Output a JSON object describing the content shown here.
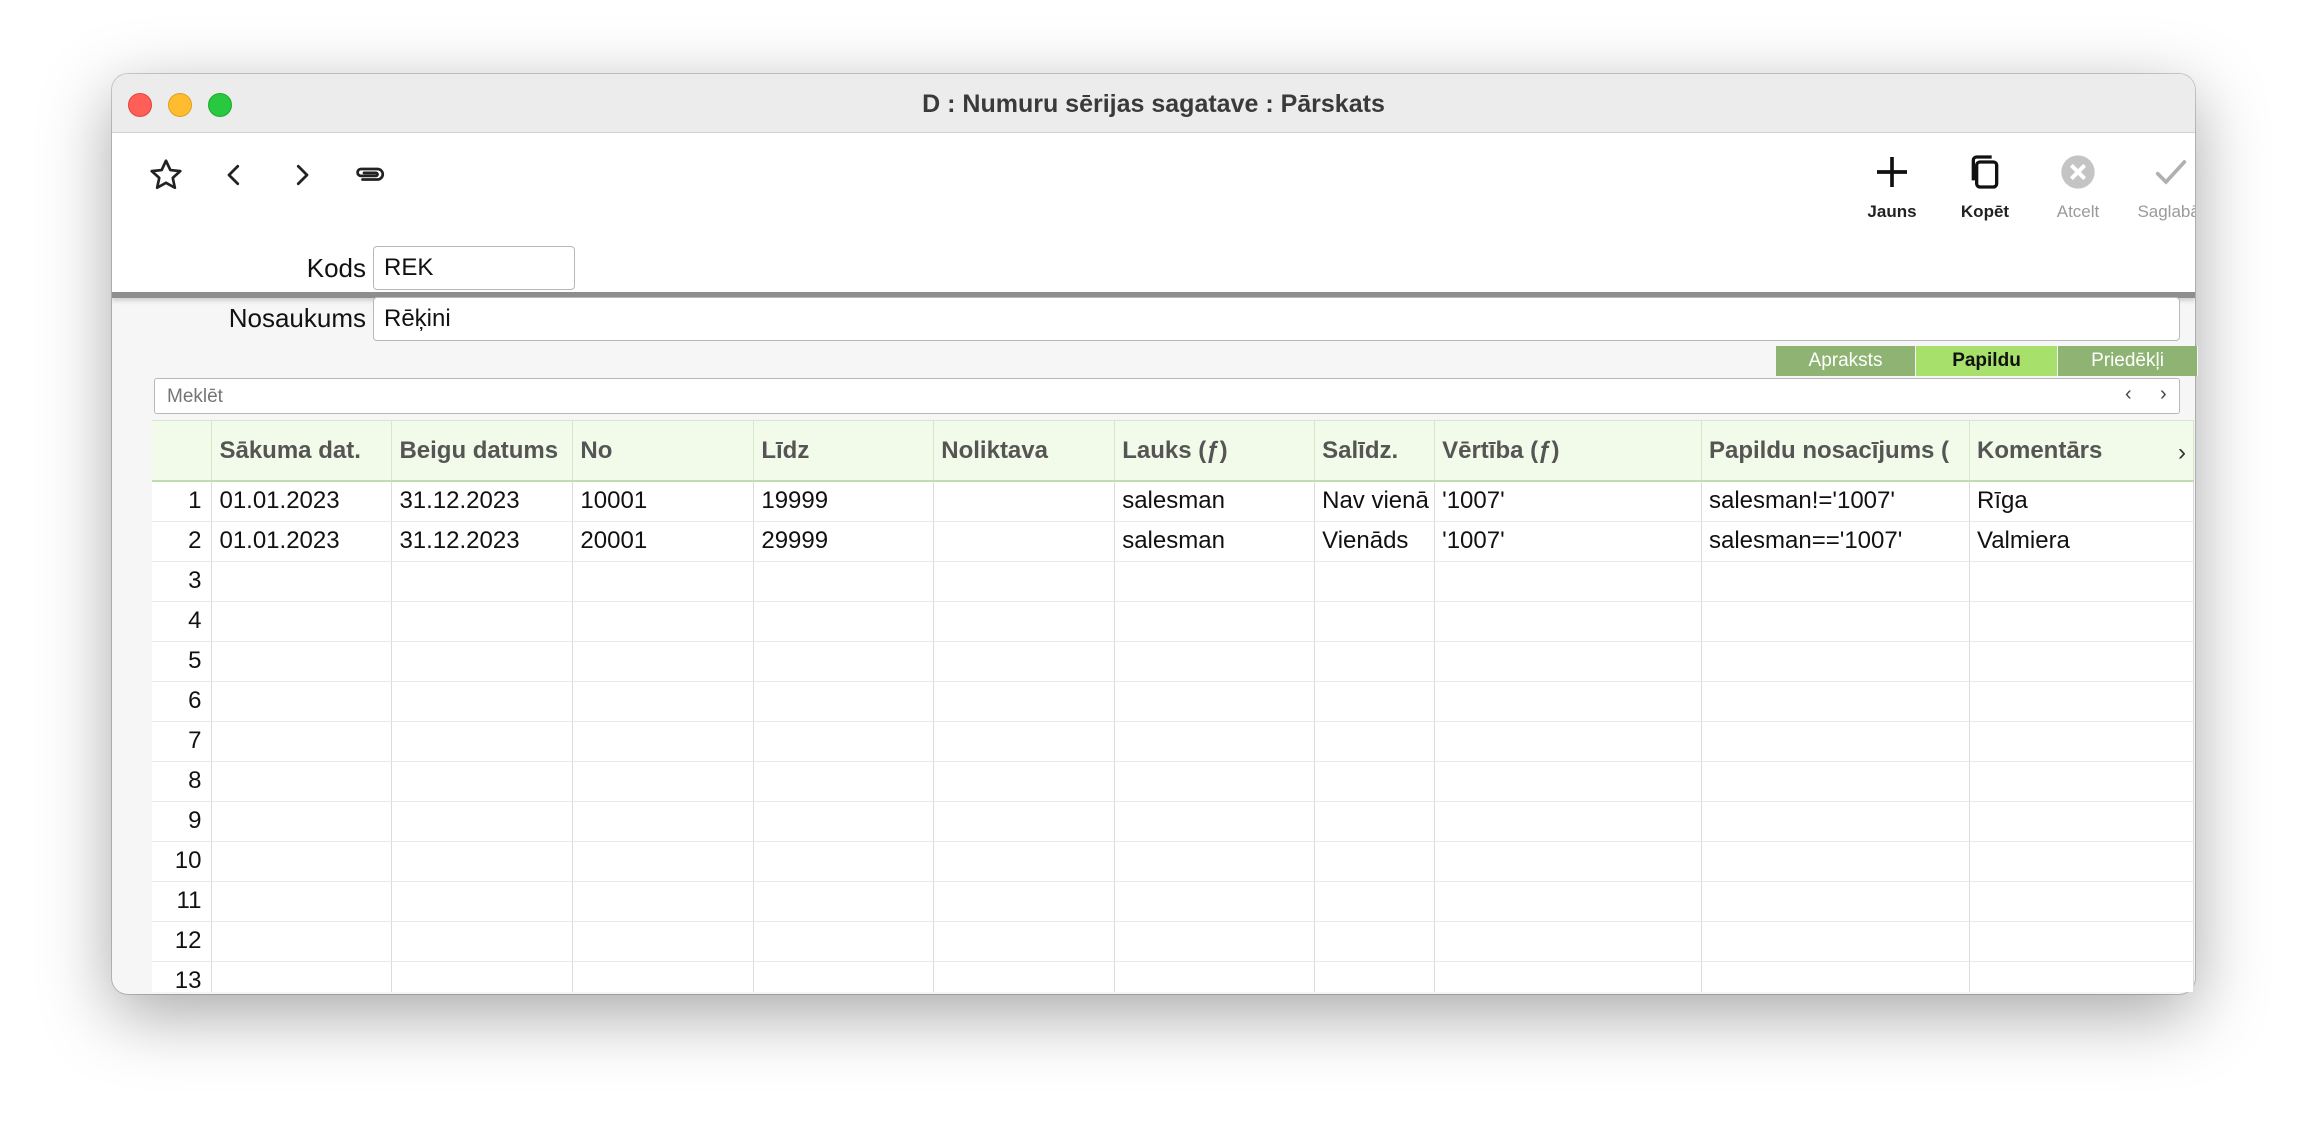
{
  "window": {
    "title": "D : Numuru sērijas sagatave : Pārskats"
  },
  "toolbar": {
    "left_icons": [
      "star-icon",
      "chevron-left-icon",
      "chevron-right-icon",
      "paperclip-icon"
    ],
    "actions": {
      "new": "Jauns",
      "copy": "Kopēt",
      "cancel": "Atcelt",
      "save": "Saglabāt"
    }
  },
  "form": {
    "code_label": "Kods",
    "code_value": "REK",
    "name_label": "Nosaukums",
    "name_value": "Rēķini"
  },
  "tabs": [
    {
      "label": "Apraksts",
      "active": false
    },
    {
      "label": "Papildu",
      "active": true
    },
    {
      "label": "Priedēkļi",
      "active": false
    }
  ],
  "search": {
    "placeholder": "Meklēt"
  },
  "grid": {
    "columns": [
      "Sākuma dat.",
      "Beigu datums",
      "No",
      "Līdz",
      "Noliktava",
      "Lauks (ƒ)",
      "Salīdz.",
      "Vērtība (ƒ)",
      "Papildu nosacījums (",
      "Komentārs"
    ],
    "rows": [
      {
        "num": "1",
        "cells": [
          "01.01.2023",
          "31.12.2023",
          "10001",
          "19999",
          "",
          "salesman",
          "Nav vienā",
          "'1007'",
          "salesman!='1007'",
          "Rīga"
        ]
      },
      {
        "num": "2",
        "cells": [
          "01.01.2023",
          "31.12.2023",
          "20001",
          "29999",
          "",
          "salesman",
          "Vienāds",
          "'1007'",
          "salesman=='1007'",
          "Valmiera"
        ]
      },
      {
        "num": "3",
        "cells": [
          "",
          "",
          "",
          "",
          "",
          "",
          "",
          "",
          "",
          ""
        ]
      },
      {
        "num": "4",
        "cells": [
          "",
          "",
          "",
          "",
          "",
          "",
          "",
          "",
          "",
          ""
        ]
      },
      {
        "num": "5",
        "cells": [
          "",
          "",
          "",
          "",
          "",
          "",
          "",
          "",
          "",
          ""
        ]
      },
      {
        "num": "6",
        "cells": [
          "",
          "",
          "",
          "",
          "",
          "",
          "",
          "",
          "",
          ""
        ]
      },
      {
        "num": "7",
        "cells": [
          "",
          "",
          "",
          "",
          "",
          "",
          "",
          "",
          "",
          ""
        ]
      },
      {
        "num": "8",
        "cells": [
          "",
          "",
          "",
          "",
          "",
          "",
          "",
          "",
          "",
          ""
        ]
      },
      {
        "num": "9",
        "cells": [
          "",
          "",
          "",
          "",
          "",
          "",
          "",
          "",
          "",
          ""
        ]
      },
      {
        "num": "10",
        "cells": [
          "",
          "",
          "",
          "",
          "",
          "",
          "",
          "",
          "",
          ""
        ]
      },
      {
        "num": "11",
        "cells": [
          "",
          "",
          "",
          "",
          "",
          "",
          "",
          "",
          "",
          ""
        ]
      },
      {
        "num": "12",
        "cells": [
          "",
          "",
          "",
          "",
          "",
          "",
          "",
          "",
          "",
          ""
        ]
      },
      {
        "num": "13",
        "cells": [
          "",
          "",
          "",
          "",
          "",
          "",
          "",
          "",
          "",
          ""
        ]
      }
    ]
  },
  "colors": {
    "tab_inactive": "#8eb372",
    "tab_active": "#a8e06c",
    "header_bg": "#f2fbe9"
  }
}
